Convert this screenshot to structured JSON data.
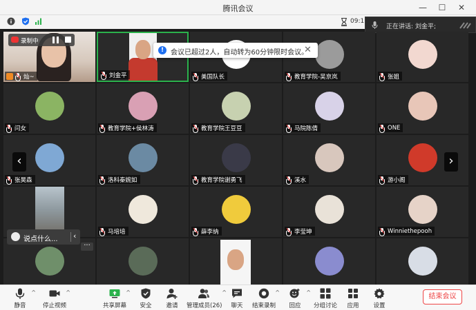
{
  "window": {
    "title": "腾讯会议"
  },
  "infobar": {
    "time": "09:11"
  },
  "speaking": {
    "label": "正在讲话:",
    "name": "刘金平;"
  },
  "recording": {
    "label": "录制中"
  },
  "toast": {
    "message": "会议已超过2人，自动转为60分钟限时会议。"
  },
  "reactions": {
    "placeholder": "说点什么..."
  },
  "participants": [
    {
      "name": "灿~",
      "avatar": "#c9a48a"
    },
    {
      "name": "刘金平",
      "avatar": "#c43a2e"
    },
    {
      "name": "美国队长",
      "avatar": "#ffffff"
    },
    {
      "name": "教育学院-吴京岚",
      "avatar": "#9b9b9b"
    },
    {
      "name": "张姐",
      "avatar": "#f2d8d0"
    },
    {
      "name": "闫女",
      "avatar": "#8bb463"
    },
    {
      "name": "教育学院+侯林涛",
      "avatar": "#d9a0b4"
    },
    {
      "name": "教育学院王豆豆",
      "avatar": "#c7d1b0"
    },
    {
      "name": "马院陈倩",
      "avatar": "#d8d2e8"
    },
    {
      "name": "ONE",
      "avatar": "#e8c6b8"
    },
    {
      "name": "张昊森",
      "avatar": "#7fa8d4"
    },
    {
      "name": "洛科秦婉如",
      "avatar": "#6b8aa3"
    },
    {
      "name": "教育学院谢勇飞",
      "avatar": "#3a3a48"
    },
    {
      "name": "溪水",
      "avatar": "#d8c7bd"
    },
    {
      "name": "游小阁",
      "avatar": "#d03a2a"
    },
    {
      "name": "",
      "avatar": "#9aa0a6"
    },
    {
      "name": "马培培",
      "avatar": "#efe8dc"
    },
    {
      "name": "薛李纳",
      "avatar": "#f0cb3c"
    },
    {
      "name": "李莹坤",
      "avatar": "#e9e2d8"
    },
    {
      "name": "Winniethepooh",
      "avatar": "#e6d3c8"
    },
    {
      "name": "",
      "avatar": "#6f8f6a"
    },
    {
      "name": "",
      "avatar": "#5a6b58"
    },
    {
      "name": "",
      "avatar": "#c8a68a"
    },
    {
      "name": "",
      "avatar": "#8a8ccf"
    },
    {
      "name": "",
      "avatar": "#d8dde6"
    }
  ],
  "toolbar": {
    "mute": "静音",
    "stop_video": "停止视频",
    "share": "共享屏幕",
    "security": "安全",
    "invite": "邀请",
    "members": "管理成员(26)",
    "chat": "聊天",
    "record": "结束录制",
    "react": "回应",
    "breakout": "分组讨论",
    "apps": "应用",
    "settings": "设置",
    "end": "结束会议"
  }
}
